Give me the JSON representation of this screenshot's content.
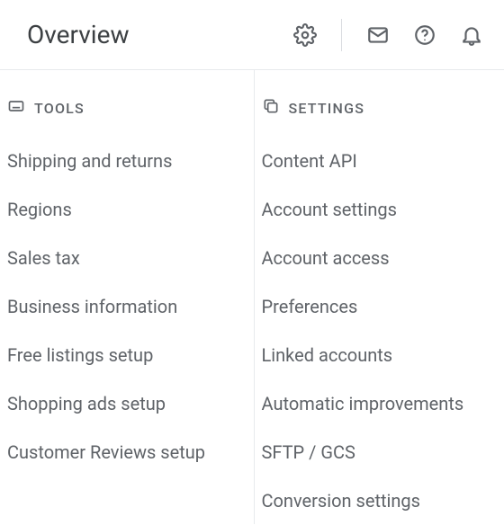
{
  "header": {
    "title": "Overview"
  },
  "tools": {
    "heading": "TOOLS",
    "items": [
      "Shipping and returns",
      "Regions",
      "Sales tax",
      "Business information",
      "Free listings setup",
      "Shopping ads setup",
      "Customer Reviews setup"
    ]
  },
  "settings": {
    "heading": "SETTINGS",
    "items": [
      "Content API",
      "Account settings",
      "Account access",
      "Preferences",
      "Linked accounts",
      "Automatic improvements",
      "SFTP / GCS",
      "Conversion settings"
    ]
  }
}
